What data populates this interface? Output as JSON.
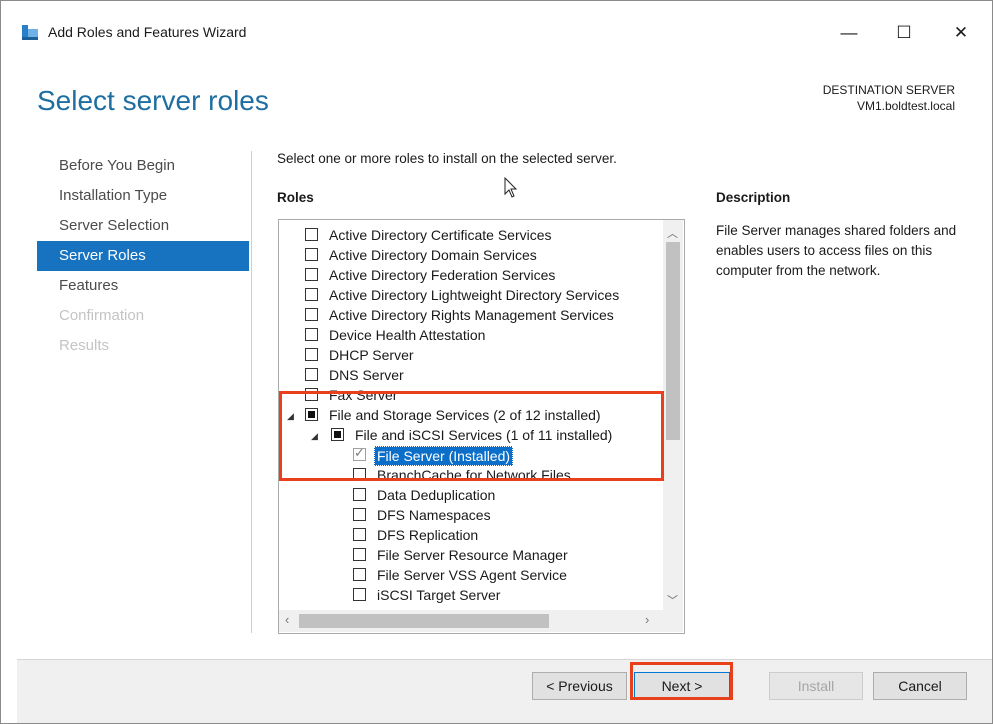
{
  "window": {
    "title": "Add Roles and Features Wizard",
    "minimize_glyph": "—",
    "maximize_glyph": "☐",
    "close_glyph": "✕"
  },
  "header": {
    "page_title": "Select server roles",
    "destination_label": "DESTINATION SERVER",
    "destination_server": "VM1.boldtest.local"
  },
  "nav": {
    "items": [
      {
        "label": "Before You Begin",
        "state": "normal"
      },
      {
        "label": "Installation Type",
        "state": "normal"
      },
      {
        "label": "Server Selection",
        "state": "normal"
      },
      {
        "label": "Server Roles",
        "state": "active"
      },
      {
        "label": "Features",
        "state": "normal"
      },
      {
        "label": "Confirmation",
        "state": "disabled"
      },
      {
        "label": "Results",
        "state": "disabled"
      }
    ]
  },
  "main": {
    "instruction": "Select one or more roles to install on the selected server.",
    "roles_heading": "Roles",
    "roles": [
      {
        "label": "Active Directory Certificate Services",
        "level": 0,
        "state": "unchecked"
      },
      {
        "label": "Active Directory Domain Services",
        "level": 0,
        "state": "unchecked"
      },
      {
        "label": "Active Directory Federation Services",
        "level": 0,
        "state": "unchecked"
      },
      {
        "label": "Active Directory Lightweight Directory Services",
        "level": 0,
        "state": "unchecked"
      },
      {
        "label": "Active Directory Rights Management Services",
        "level": 0,
        "state": "unchecked"
      },
      {
        "label": "Device Health Attestation",
        "level": 0,
        "state": "unchecked"
      },
      {
        "label": "DHCP Server",
        "level": 0,
        "state": "unchecked"
      },
      {
        "label": "DNS Server",
        "level": 0,
        "state": "unchecked"
      },
      {
        "label": "Fax Server",
        "level": 0,
        "state": "unchecked"
      },
      {
        "label": "File and Storage Services (2 of 12 installed)",
        "level": 0,
        "state": "partial",
        "expanded": true
      },
      {
        "label": "File and iSCSI Services (1 of 11 installed)",
        "level": 1,
        "state": "partial",
        "expanded": true
      },
      {
        "label": "File Server (Installed)",
        "level": 2,
        "state": "checked",
        "selected": true
      },
      {
        "label": "BranchCache for Network Files",
        "level": 2,
        "state": "unchecked"
      },
      {
        "label": "Data Deduplication",
        "level": 2,
        "state": "unchecked"
      },
      {
        "label": "DFS Namespaces",
        "level": 2,
        "state": "unchecked"
      },
      {
        "label": "DFS Replication",
        "level": 2,
        "state": "unchecked"
      },
      {
        "label": "File Server Resource Manager",
        "level": 2,
        "state": "unchecked"
      },
      {
        "label": "File Server VSS Agent Service",
        "level": 2,
        "state": "unchecked"
      },
      {
        "label": "iSCSI Target Server",
        "level": 2,
        "state": "unchecked"
      }
    ],
    "description_heading": "Description",
    "description_text": "File Server manages shared folders and enables users to access files on this computer from the network."
  },
  "footer": {
    "previous_label": "< Previous",
    "next_label": "Next >",
    "install_label": "Install",
    "cancel_label": "Cancel"
  },
  "colors": {
    "accent": "#1773bf",
    "title_blue": "#1e6ea1",
    "highlight_red": "#e8401a",
    "selection_blue": "#0b6fc9"
  }
}
